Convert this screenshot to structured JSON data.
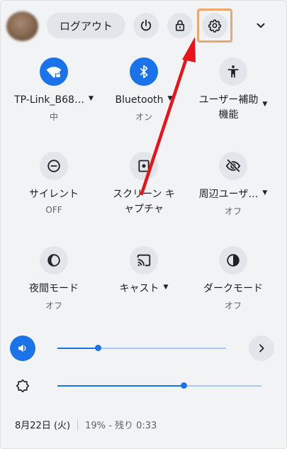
{
  "header": {
    "logout_label": "ログアウト",
    "power_icon": "power-icon",
    "lock_icon": "lock-icon",
    "settings_icon": "gear-icon",
    "collapse_icon": "chevron-down-icon"
  },
  "tiles": [
    {
      "label": "TP-Link_B68…",
      "sub": "中",
      "icon": "wifi-lock-icon",
      "on": true,
      "caret": true
    },
    {
      "label": "Bluetooth",
      "sub": "オン",
      "icon": "bluetooth-icon",
      "on": true,
      "caret": true
    },
    {
      "label1": "ユーザー補助",
      "label2": "機能",
      "icon": "accessibility-icon",
      "on": false,
      "caret": true
    },
    {
      "label": "サイレント",
      "sub": "OFF",
      "icon": "do-not-disturb-icon",
      "on": false,
      "caret": false
    },
    {
      "label1": "スクリーン キ",
      "label2": "ャプチャ",
      "icon": "screen-capture-icon",
      "on": false,
      "caret": false
    },
    {
      "label": "周辺ユーザ…",
      "sub": "オフ",
      "icon": "nearby-share-icon",
      "on": false,
      "caret": true
    },
    {
      "label": "夜間モード",
      "sub": "オフ",
      "icon": "night-light-icon",
      "on": false,
      "caret": false
    },
    {
      "label": "キャスト",
      "icon": "cast-icon",
      "on": false,
      "caret": true
    },
    {
      "label": "ダークモード",
      "sub": "オフ",
      "icon": "dark-mode-icon",
      "on": false,
      "caret": false
    }
  ],
  "volume": {
    "icon": "volume-icon",
    "level": 0.24,
    "more_icon": "chevron-right-icon"
  },
  "brightness": {
    "icon": "brightness-icon",
    "level": 0.62
  },
  "footer": {
    "date": "8月22日 (火)",
    "battery": "19% - 残り 0:33"
  },
  "colors": {
    "accent": "#1a73e8",
    "highlight": "#f0a56a",
    "arrow": "#e8141a"
  }
}
